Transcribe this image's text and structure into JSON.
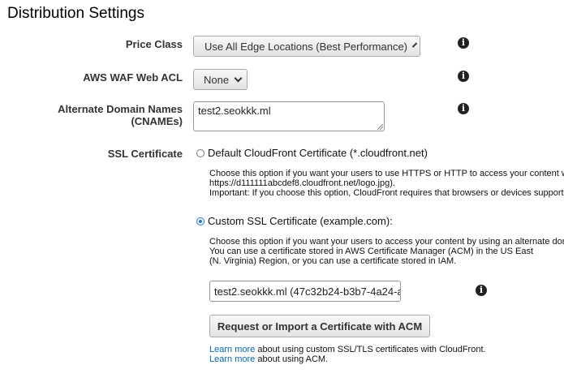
{
  "page": {
    "title": "Distribution Settings"
  },
  "price_class": {
    "label": "Price Class",
    "value": "Use All Edge Locations (Best Performance)"
  },
  "waf": {
    "label": "AWS WAF Web ACL",
    "value": "None"
  },
  "cnames": {
    "label_line1": "Alternate Domain Names",
    "label_line2": "(CNAMEs)",
    "value": "test2.seokkk.ml"
  },
  "ssl": {
    "label": "SSL Certificate",
    "default_option": {
      "label": "Default CloudFront Certificate (*.cloudfront.net)",
      "help_line1": "Choose this option if you want your users to use HTTPS or HTTP to access your content with",
      "help_line2": "https://d111111abcdef8.cloudfront.net/logo.jpg).",
      "help_line3": "Important: If you choose this option, CloudFront requires that browsers or devices support T"
    },
    "custom_option": {
      "label": "Custom SSL Certificate (example.com):",
      "help_line1": "Choose this option if you want your users to access your content by using an alternate doma",
      "help_line2": "You can use a certificate stored in AWS Certificate Manager (ACM) in the US East",
      "help_line3": "(N. Virginia) Region, or you can use a certificate stored in IAM."
    },
    "certificate_value": "test2.seokkk.ml (47c32b24-b3b7-4a24-a",
    "request_button": "Request or Import a Certificate with ACM",
    "learn_more_1": {
      "link": "Learn more",
      "text": " about using custom SSL/TLS certificates with CloudFront."
    },
    "learn_more_2": {
      "link": "Learn more",
      "text": " about using ACM."
    }
  },
  "icons": {
    "info": "info-icon",
    "dropdown": "chevron-down-icon"
  },
  "colors": {
    "link": "#0066c0",
    "radio_checked": "#1a73e8"
  }
}
